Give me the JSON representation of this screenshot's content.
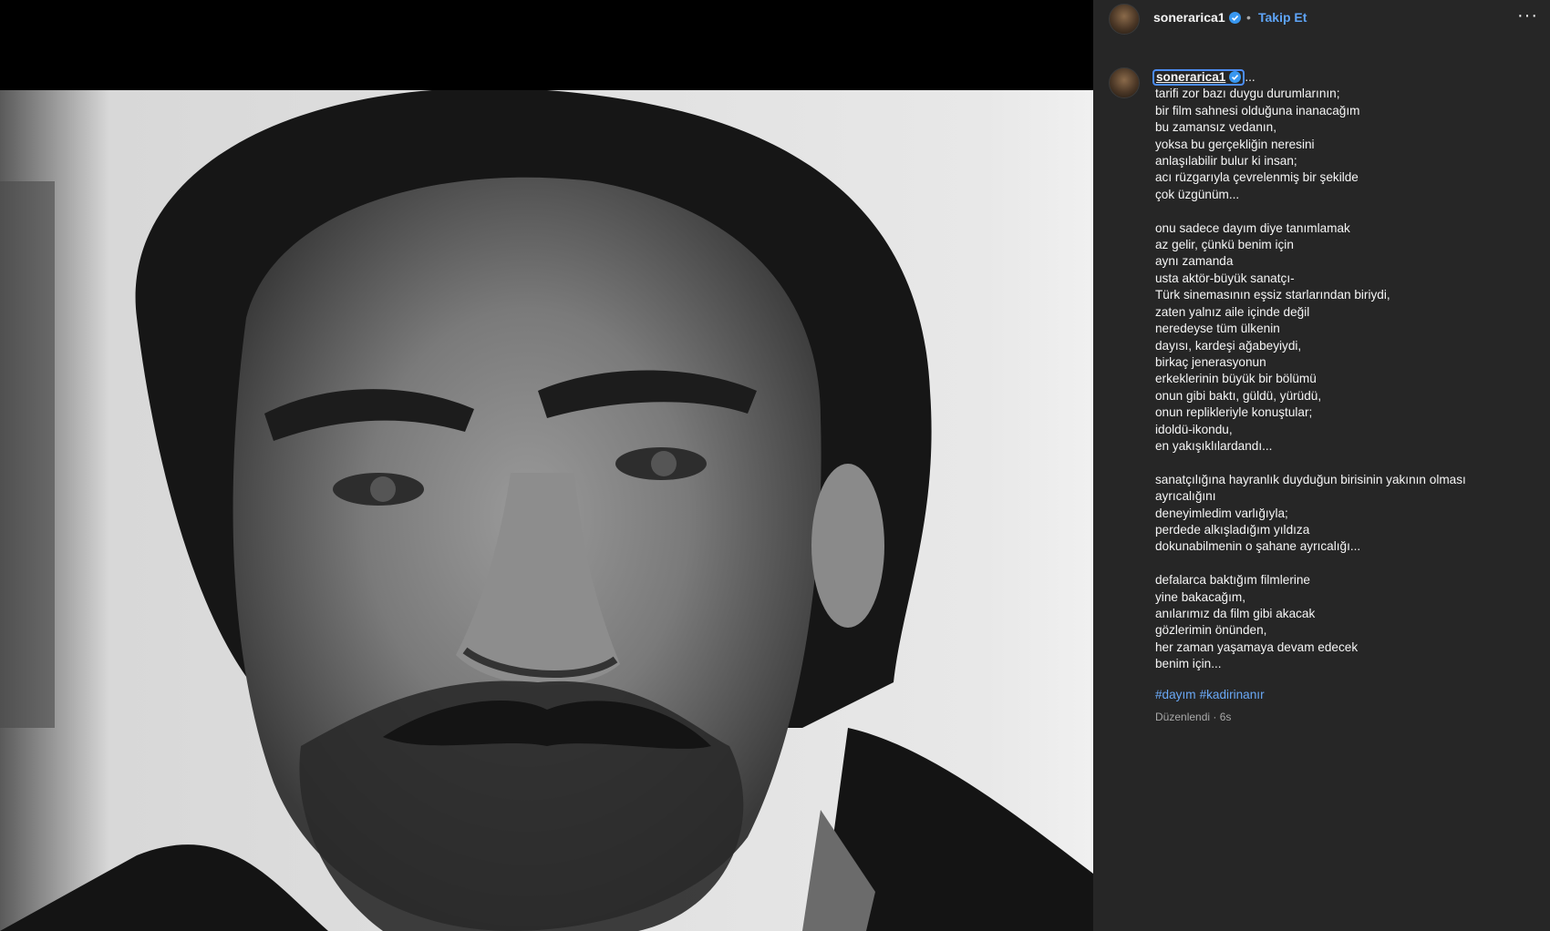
{
  "post": {
    "username": "sonerarica1",
    "follow_label": "Takip Et",
    "separator": "•",
    "more_label": "···",
    "caption_suffix": "...",
    "caption": "tarifi zor bazı duygu durumlarının;\nbir film sahnesi olduğuna inanacağım\nbu zamansız vedanın,\nyoksa bu gerçekliğin neresini\nanlaşılabilir bulur ki insan;\nacı rüzgarıyla çevrelenmiş bir şekilde\nçok üzgünüm...\n\nonu sadece dayım diye tanımlamak\naz gelir, çünkü benim için\naynı zamanda\nusta aktör-büyük sanatçı-\nTürk sinemasının eşsiz starlarından biriydi,\nzaten yalnız aile içinde değil\nneredeyse tüm ülkenin\ndayısı, kardeşi ağabeyiydi,\nbirkaç jenerasyonun\nerkeklerinin büyük bir bölümü\nonun gibi baktı, güldü, yürüdü,\nonun replikleriyle konuştular;\nidoldü-ikondu,\nen yakışıklılardandı...\n\nsanatçılığına hayranlık duyduğun birisinin yakının olması\nayrıcalığını\ndeneyimledim varlığıyla;\nperdede alkışladığım yıldıza\ndokunabilmenin o şahane ayrıcalığı...\n\ndefalarca baktığım filmlerine\nyine bakacağım,\nanılarımız da film gibi akacak\ngözlerimin önünden,\nher zaman yaşamaya devam edecek\nbenim için...",
    "hashtags": [
      "#dayım",
      "#kadirinanır"
    ],
    "meta": "Düzenlendi · 6s"
  },
  "colors": {
    "panel_bg": "#262626",
    "link_blue": "#5ea4f7",
    "hashtag_blue": "#6aa8f5",
    "verified_blue": "#3897f0"
  }
}
